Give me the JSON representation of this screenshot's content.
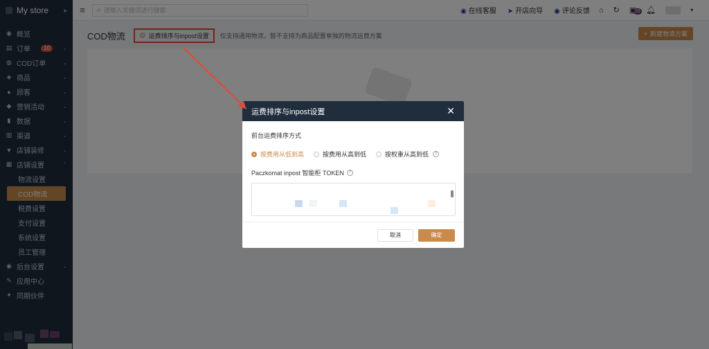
{
  "sidebar": {
    "brand": "My store",
    "items": [
      {
        "icon": "dashboard-icon",
        "glyph": "◉",
        "label": "概览"
      },
      {
        "icon": "orders-icon",
        "glyph": "▤",
        "label": "订单",
        "badge": "10"
      },
      {
        "icon": "cod-orders-icon",
        "glyph": "◍",
        "label": "COD订单"
      },
      {
        "icon": "products-icon",
        "glyph": "◈",
        "label": "商品"
      },
      {
        "icon": "customers-icon",
        "glyph": "●",
        "label": "顾客"
      },
      {
        "icon": "marketing-icon",
        "glyph": "◆",
        "label": "营销活动"
      },
      {
        "icon": "data-icon",
        "glyph": "▮",
        "label": "数据"
      },
      {
        "icon": "channels-icon",
        "glyph": "▥",
        "label": "渠道"
      },
      {
        "icon": "store-decor-icon",
        "glyph": "▼",
        "label": "店铺装修"
      },
      {
        "icon": "store-settings-icon",
        "glyph": "▦",
        "label": "店铺设置"
      }
    ],
    "sub_items": [
      "物流设置",
      "COD物流",
      "税费设置",
      "支付设置",
      "系统设置",
      "员工管理"
    ],
    "active_sub": "COD物流",
    "bottom_items": [
      {
        "icon": "backend-settings-icon",
        "glyph": "◉",
        "label": "后台设置"
      },
      {
        "icon": "app-center-icon",
        "glyph": "✎",
        "label": "应用中心"
      },
      {
        "icon": "partner-icon",
        "glyph": "✦",
        "label": "同期伙伴"
      }
    ]
  },
  "topbar": {
    "search_placeholder": "请输入关键词进行搜索",
    "links": [
      {
        "icon": "headset-icon",
        "glyph": "◉",
        "label": "在线客服"
      },
      {
        "icon": "send-icon",
        "glyph": "➤",
        "label": "开店向导"
      },
      {
        "icon": "feedback-icon",
        "glyph": "◉",
        "label": "评论反馈"
      }
    ],
    "notif_badge": "10"
  },
  "page": {
    "title": "COD物流",
    "sort_link": "运费排序与inpost设置",
    "hint": "仅支持通用物流，暂不支持为商品配置单独的物流运费方案",
    "new_button": "新建物流方案"
  },
  "dialog": {
    "title": "运费排序与inpost设置",
    "section_label": "前台运费排序方式",
    "options": [
      "按费用从低到高",
      "按费用从高到低",
      "按权重从高到低"
    ],
    "selected_option": "按费用从低到高",
    "token_label": "Paczkomat inpost 智能柜 TOKEN",
    "cancel": "取消",
    "confirm": "确定"
  },
  "colors": {
    "accent": "#c98a4b",
    "sidebar_bg": "#1f2d3d",
    "annotation_red": "#e0493b"
  }
}
